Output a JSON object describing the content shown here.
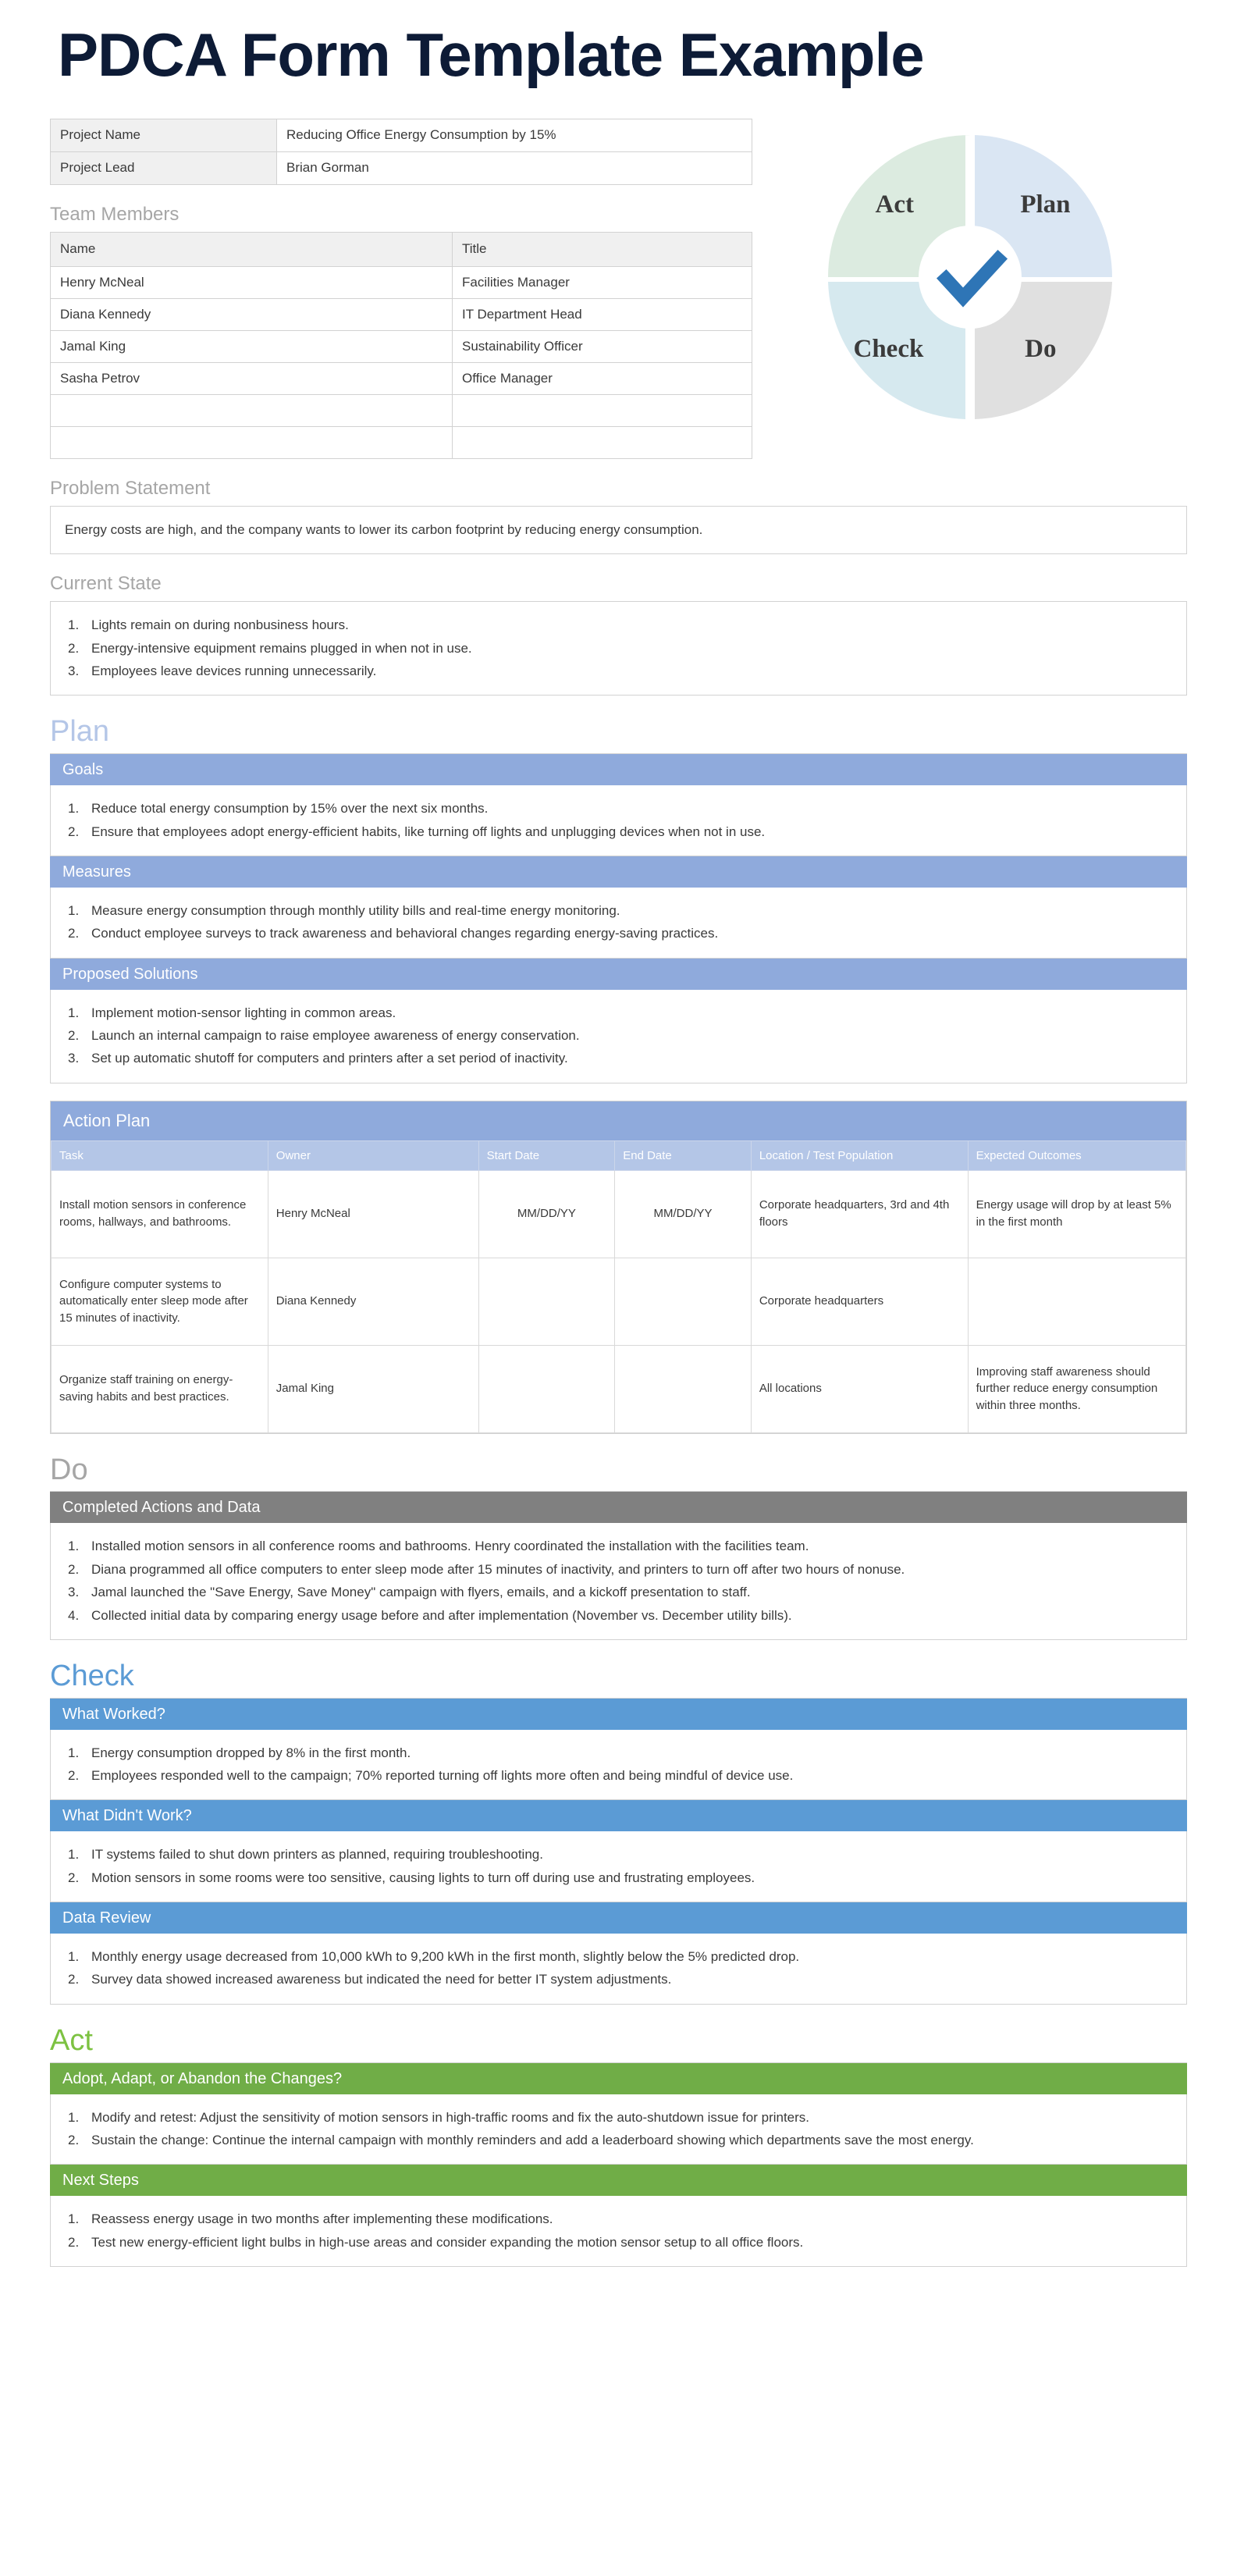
{
  "title": "PDCA Form Template Example",
  "project_info": {
    "rows": [
      {
        "label": "Project Name",
        "value": "Reducing Office Energy Consumption by 15%"
      },
      {
        "label": "Project Lead",
        "value": "Brian Gorman"
      }
    ]
  },
  "team": {
    "heading": "Team Members",
    "columns": [
      "Name",
      "Title"
    ],
    "rows": [
      {
        "name": "Henry McNeal",
        "title": "Facilities Manager"
      },
      {
        "name": "Diana Kennedy",
        "title": "IT Department Head"
      },
      {
        "name": "Jamal King",
        "title": "Sustainability Officer"
      },
      {
        "name": "Sasha Petrov",
        "title": "Office Manager"
      },
      {
        "name": "",
        "title": ""
      },
      {
        "name": "",
        "title": ""
      }
    ]
  },
  "wheel": {
    "act": "Act",
    "plan": "Plan",
    "check": "Check",
    "do": "Do",
    "colors": {
      "act": "#dcebe0",
      "plan": "#dae6f3",
      "check": "#d6e9ef",
      "do": "#e0e0e0",
      "check_mark": "#2e75b6"
    }
  },
  "problem": {
    "heading": "Problem Statement",
    "text": "Energy costs are high, and the company wants to lower its carbon footprint by reducing energy consumption."
  },
  "current_state": {
    "heading": "Current State",
    "items": [
      "Lights remain on during nonbusiness hours.",
      "Energy-intensive equipment remains plugged in when not in use.",
      "Employees leave devices running unnecessarily."
    ]
  },
  "plan": {
    "phase_title": "Plan",
    "goals": {
      "header": "Goals",
      "items": [
        "Reduce total energy consumption by 15% over the next six months.",
        "Ensure that employees adopt energy-efficient habits, like turning off lights and unplugging devices when not in use."
      ]
    },
    "measures": {
      "header": "Measures",
      "items": [
        "Measure energy consumption through monthly utility bills and real-time energy monitoring.",
        "Conduct employee surveys to track awareness and behavioral changes regarding energy-saving practices."
      ]
    },
    "proposed_solutions": {
      "header": "Proposed Solutions",
      "items": [
        "Implement motion-sensor lighting in common areas.",
        "Launch an internal campaign to raise employee awareness of energy conservation.",
        "Set up automatic shutoff for computers and printers after a set period of inactivity."
      ]
    },
    "action_plan": {
      "header": "Action Plan",
      "columns": [
        "Task",
        "Owner",
        "Start Date",
        "End Date",
        "Location / Test Population",
        "Expected Outcomes"
      ],
      "rows": [
        {
          "task": "Install motion sensors in conference rooms, hallways, and bathrooms.",
          "owner": "Henry McNeal",
          "start": "MM/DD/YY",
          "end": "MM/DD/YY",
          "location": "Corporate headquarters, 3rd and 4th floors",
          "outcome": "Energy usage will drop by at least 5% in the first month"
        },
        {
          "task": "Configure computer systems to automatically enter sleep mode after 15 minutes of inactivity.",
          "owner": "Diana Kennedy",
          "start": "",
          "end": "",
          "location": "Corporate headquarters",
          "outcome": ""
        },
        {
          "task": "Organize staff training on energy-saving habits and best practices.",
          "owner": "Jamal King",
          "start": "",
          "end": "",
          "location": "All locations",
          "outcome": "Improving staff awareness should further reduce energy consumption within three months."
        }
      ]
    }
  },
  "do": {
    "phase_title": "Do",
    "completed": {
      "header": "Completed Actions and Data",
      "items": [
        "Installed motion sensors in all conference rooms and bathrooms. Henry coordinated the installation with the facilities team.",
        "Diana programmed all office computers to enter sleep mode after 15 minutes of inactivity, and printers to turn off after two hours of nonuse.",
        "Jamal launched the \"Save Energy, Save Money\" campaign with flyers, emails, and a kickoff presentation to staff.",
        "Collected initial data by comparing energy usage before and after implementation (November vs. December utility bills)."
      ]
    }
  },
  "check": {
    "phase_title": "Check",
    "what_worked": {
      "header": "What Worked?",
      "items": [
        "Energy consumption dropped by 8% in the first month.",
        "Employees responded well to the campaign; 70% reported turning off lights more often and being mindful of device use."
      ]
    },
    "what_didnt_work": {
      "header": "What Didn't Work?",
      "items": [
        "IT systems failed to shut down printers as planned, requiring troubleshooting.",
        "Motion sensors in some rooms were too sensitive, causing lights to turn off during use and frustrating employees."
      ]
    },
    "data_review": {
      "header": "Data Review",
      "items": [
        "Monthly energy usage decreased from 10,000 kWh to 9,200 kWh in the first month, slightly below the 5% predicted drop.",
        "Survey data showed increased awareness but indicated the need for better IT system adjustments."
      ]
    }
  },
  "act": {
    "phase_title": "Act",
    "adopt": {
      "header": "Adopt, Adapt, or Abandon the Changes?",
      "items": [
        "Modify and retest: Adjust the sensitivity of motion sensors in high-traffic rooms and fix the auto-shutdown issue for printers.",
        "Sustain the change: Continue the internal campaign with monthly reminders and add a leaderboard showing which departments save the most energy."
      ]
    },
    "next_steps": {
      "header": "Next Steps",
      "items": [
        "Reassess energy usage in two months after implementing these modifications.",
        "Test new energy-efficient light bulbs in high-use areas and consider expanding the motion sensor setup to all office floors."
      ]
    }
  }
}
